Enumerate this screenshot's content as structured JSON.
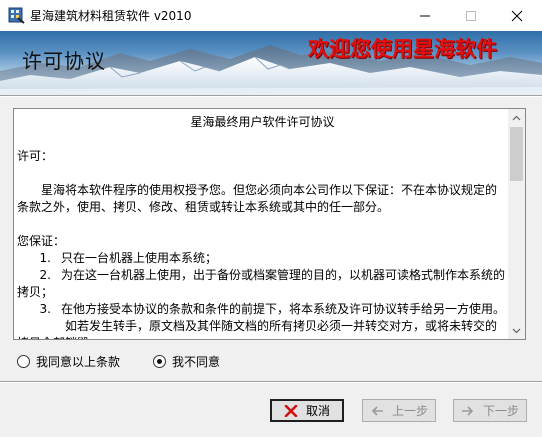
{
  "window": {
    "title": "星海建筑材料租赁软件 v2010"
  },
  "banner": {
    "heading": "许可协议",
    "slogan": "欢迎您使用星海软件"
  },
  "license": {
    "title": "星海最终用户软件许可协议",
    "lines": [
      "许可：",
      "星海将本软件程序的使用权授予您。但您必须向本公司作以下保证：不在本协议规定的条款之外，使用、拷贝、修改、租赁或转让本系统或其中的任一部分。",
      "您保证：",
      "1.",
      "只在一台机器上使用本系统；",
      "2.",
      "为在这一台机器上使用，出于备份或档案管理的目的，以机器可读格式制作本系统的拷贝；",
      "3.",
      "在他方接受本协议的条款和条件的前提下，将本系统及许可协议转手给另一方使用。",
      "如若发生转手，原文档及其伴随文档的所有拷贝必须一并转交对方，或将未转交的拷贝全部销毁。"
    ]
  },
  "options": {
    "agree_label": "我同意以上条款",
    "disagree_label": "我不同意",
    "selected": "disagree"
  },
  "buttons": {
    "cancel_label": "取消",
    "prev_label": "上一步",
    "next_label": "下一步"
  },
  "colors": {
    "slogan": "#e11010",
    "cancel_icon": "#d01010"
  }
}
